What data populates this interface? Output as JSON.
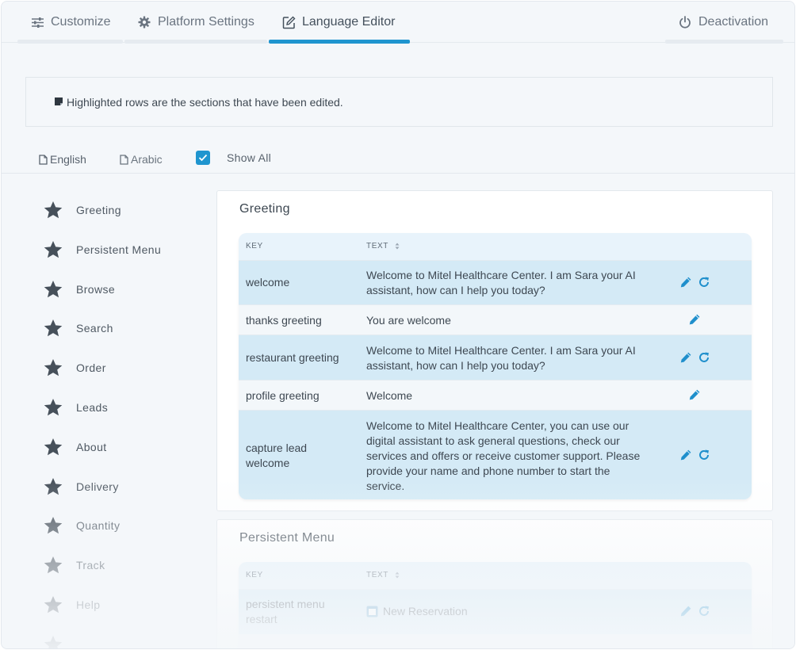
{
  "tabs": [
    {
      "label": "Customize",
      "icon": "sliders-icon",
      "active": false
    },
    {
      "label": "Platform Settings",
      "icon": "gear-icon",
      "active": false
    },
    {
      "label": "Language Editor",
      "icon": "edit-icon",
      "active": true
    },
    {
      "label": "Deactivation",
      "icon": "power-icon",
      "active": false
    }
  ],
  "note": {
    "icon": "note-icon",
    "text": "Highlighted rows are the sections that have been edited."
  },
  "languages": [
    {
      "label": "English",
      "icon": "file-icon"
    },
    {
      "label": "Arabic",
      "icon": "file-icon"
    }
  ],
  "show_all": {
    "label": "Show All",
    "checked": true
  },
  "sidebar": {
    "items": [
      {
        "label": "Greeting",
        "icon": "star-icon"
      },
      {
        "label": "Persistent Menu",
        "icon": "star-icon"
      },
      {
        "label": "Browse",
        "icon": "star-icon"
      },
      {
        "label": "Search",
        "icon": "star-icon"
      },
      {
        "label": "Order",
        "icon": "star-icon"
      },
      {
        "label": "Leads",
        "icon": "star-icon"
      },
      {
        "label": "About",
        "icon": "star-icon"
      },
      {
        "label": "Delivery",
        "icon": "star-icon"
      },
      {
        "label": "Quantity",
        "icon": "star-icon"
      },
      {
        "label": "Track",
        "icon": "star-icon"
      },
      {
        "label": "Help",
        "icon": "star-icon"
      }
    ]
  },
  "table_headers": {
    "key": "KEY",
    "text": "TEXT"
  },
  "sections": [
    {
      "title": "Greeting",
      "rows": [
        {
          "key": "welcome",
          "text": "Welcome to Mitel Healthcare Center. I am Sara your AI assistant, how can I help you today?",
          "edited": true
        },
        {
          "key": "thanks greeting",
          "text": "You are welcome",
          "edited": false
        },
        {
          "key": "restaurant greeting",
          "text": "Welcome to Mitel Healthcare Center. I am Sara your AI assistant, how can I help you today?",
          "edited": true
        },
        {
          "key": "profile greeting",
          "text": "Welcome",
          "edited": false
        },
        {
          "key": "capture lead welcome",
          "text": "Welcome to Mitel Healthcare Center, you can use our digital assistant to ask general questions, check our services and offers or receive customer support. Please provide your name and phone number to start the service.",
          "edited": true
        }
      ]
    },
    {
      "title": "Persistent Menu",
      "rows": [
        {
          "key": "persistent menu restart",
          "text": "New Reservation",
          "edited": true
        }
      ]
    }
  ],
  "colors": {
    "accent": "#1f95cf",
    "highlight_row": "#d4eaf6",
    "plain_row": "#f3f7fa",
    "header_row": "#e8f3fb",
    "background": "#f4f7fa"
  }
}
